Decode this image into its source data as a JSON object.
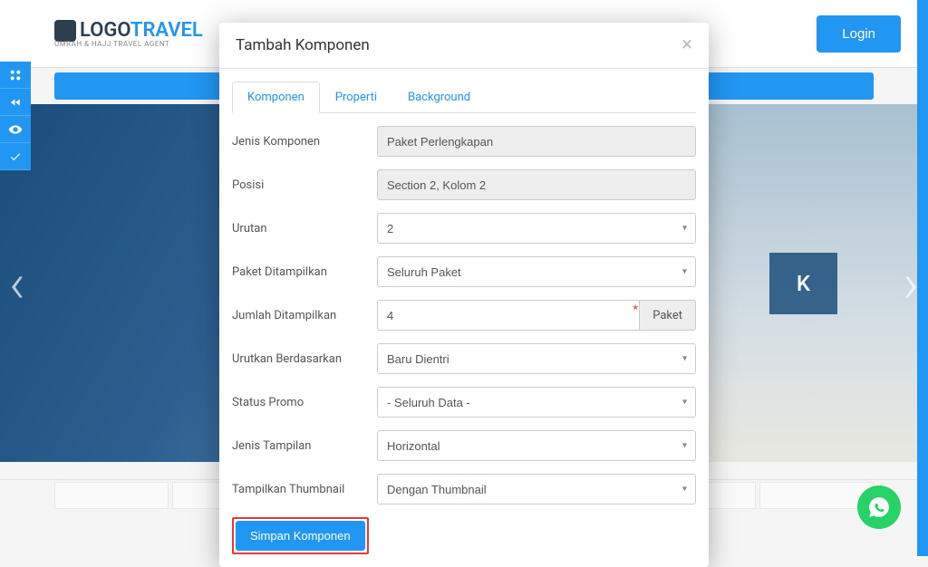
{
  "header": {
    "logo_prefix": "LOGO",
    "logo_suffix": "TRAVEL",
    "logo_tagline": "UMRAH & HAJJ TRAVEL AGENT",
    "login_label": "Login"
  },
  "hero": {
    "badge_text": "K"
  },
  "modal": {
    "title": "Tambah Komponen",
    "close": "×",
    "tabs": {
      "komponen": "Komponen",
      "properti": "Properti",
      "background": "Background"
    },
    "fields": {
      "jenis_komponen": {
        "label": "Jenis Komponen",
        "value": "Paket Perlengkapan"
      },
      "posisi": {
        "label": "Posisi",
        "value": "Section 2, Kolom 2"
      },
      "urutan": {
        "label": "Urutan",
        "value": "2"
      },
      "paket_ditampilkan": {
        "label": "Paket Ditampilkan",
        "value": "Seluruh Paket"
      },
      "jumlah_ditampilkan": {
        "label": "Jumlah Ditampilkan",
        "value": "4",
        "addon": "Paket"
      },
      "urutkan_berdasarkan": {
        "label": "Urutkan Berdasarkan",
        "value": "Baru Dientri"
      },
      "status_promo": {
        "label": "Status Promo",
        "value": "- Seluruh Data -"
      },
      "jenis_tampilan": {
        "label": "Jenis Tampilan",
        "value": "Horizontal"
      },
      "tampilkan_thumbnail": {
        "label": "Tampilkan Thumbnail",
        "value": "Dengan Thumbnail"
      }
    },
    "submit_label": "Simpan Komponen"
  },
  "plus_icon": "+"
}
